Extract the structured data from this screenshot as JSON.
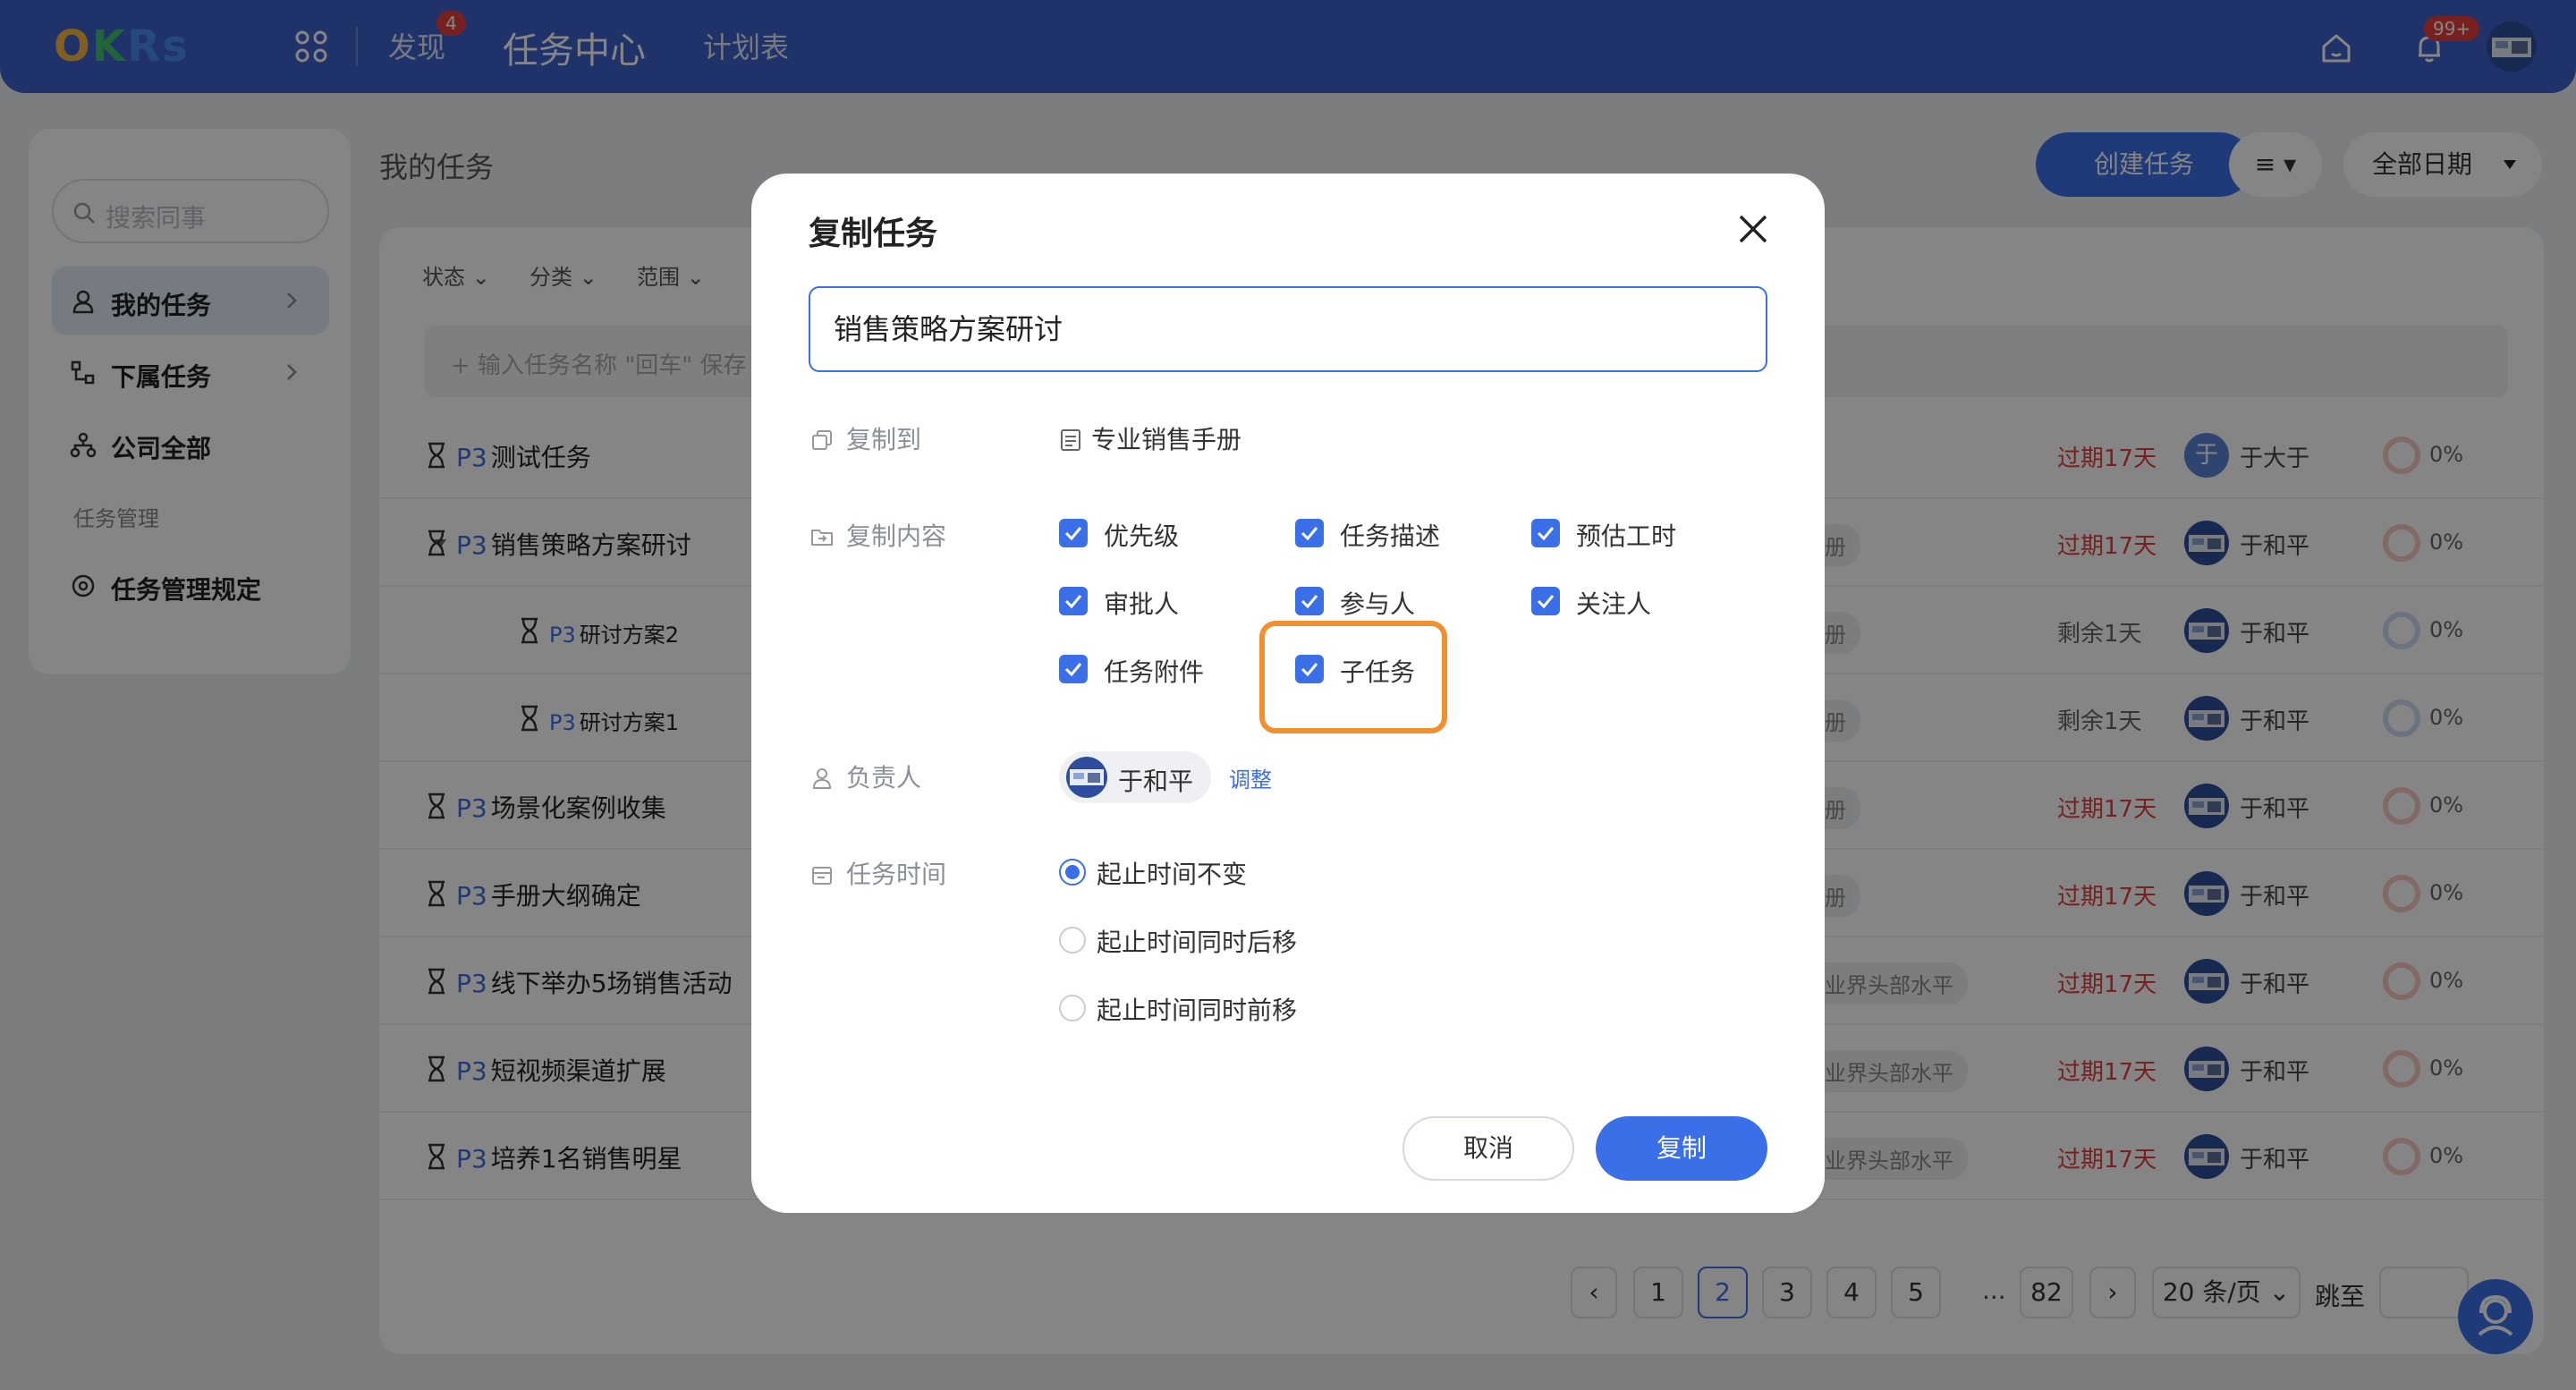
{
  "topbar": {
    "logo": [
      "O",
      "K",
      "Rs"
    ],
    "nav": [
      {
        "label": "发现",
        "badge": "4"
      },
      {
        "label": "任务中心"
      },
      {
        "label": "计划表"
      }
    ],
    "notify_badge": "99+"
  },
  "sidebar": {
    "search_placeholder": "搜索同事",
    "items": [
      {
        "label": "我的任务"
      },
      {
        "label": "下属任务"
      },
      {
        "label": "公司全部"
      }
    ],
    "group_label": "任务管理",
    "rules_label": "任务管理规定"
  },
  "main": {
    "title": "我的任务",
    "create_button": "创建任务",
    "view_icon": "≡ ▾",
    "date_filter": "全部日期",
    "filters": [
      "状态",
      "分类",
      "范围"
    ],
    "quick_add_placeholder": "+ 输入任务名称 \"回车\" 保存"
  },
  "tasks": [
    {
      "priority": "P3",
      "name": "测试任务",
      "tag": "",
      "due": "过期17天",
      "due_color": "red",
      "owner": "于大于",
      "avatar": "于",
      "progress": "0%"
    },
    {
      "priority": "P3",
      "name": "销售策略方案研讨",
      "tag": "册",
      "due": "过期17天",
      "due_color": "red",
      "owner": "于和平",
      "progress": "0%"
    },
    {
      "priority": "P3",
      "name": "研讨方案2",
      "tag": "册",
      "due": "剩余1天",
      "due_color": "gray",
      "owner": "于和平",
      "progress": "0%"
    },
    {
      "priority": "P3",
      "name": "研讨方案1",
      "tag": "册",
      "due": "剩余1天",
      "due_color": "gray",
      "owner": "于和平",
      "progress": "0%"
    },
    {
      "priority": "P3",
      "name": "场景化案例收集",
      "tag": "册",
      "due": "过期17天",
      "due_color": "red",
      "owner": "于和平",
      "progress": "0%"
    },
    {
      "priority": "P3",
      "name": "手册大纲确定",
      "tag": "册",
      "due": "过期17天",
      "due_color": "red",
      "owner": "于和平",
      "progress": "0%"
    },
    {
      "priority": "P3",
      "name": "线下举办5场销售活动",
      "tag": "业界头部水平",
      "due": "过期17天",
      "due_color": "red",
      "owner": "于和平",
      "progress": "0%"
    },
    {
      "priority": "P3",
      "name": "短视频渠道扩展",
      "tag": "业界头部水平",
      "due": "过期17天",
      "due_color": "red",
      "owner": "于和平",
      "progress": "0%"
    },
    {
      "priority": "P3",
      "name": "培养1名销售明星",
      "tag": "业界头部水平",
      "due": "过期17天",
      "due_color": "red",
      "owner": "于和平",
      "progress": "0%"
    }
  ],
  "pagination": {
    "pages": [
      "1",
      "2",
      "3",
      "4",
      "5"
    ],
    "current": "2",
    "dots": "...",
    "last": "82",
    "per_page": "20 条/页",
    "jump_label": "跳至"
  },
  "modal": {
    "title": "复制任务",
    "name_value": "销售策略方案研讨",
    "copy_to_label": "复制到",
    "copy_to_value": "专业销售手册",
    "content_label": "复制内容",
    "checkboxes": [
      {
        "label": "优先级",
        "checked": true
      },
      {
        "label": "任务描述",
        "checked": true
      },
      {
        "label": "预估工时",
        "checked": true
      },
      {
        "label": "审批人",
        "checked": true
      },
      {
        "label": "参与人",
        "checked": true
      },
      {
        "label": "关注人",
        "checked": true
      },
      {
        "label": "任务附件",
        "checked": true
      },
      {
        "label": "子任务",
        "checked": true
      }
    ],
    "owner_label": "负责人",
    "owner_name": "于和平",
    "adjust_label": "调整",
    "time_label": "任务时间",
    "time_options": [
      {
        "label": "起止时间不变",
        "selected": true
      },
      {
        "label": "起止时间同时后移",
        "selected": false
      },
      {
        "label": "起止时间同时前移",
        "selected": false
      }
    ],
    "cancel_label": "取消",
    "confirm_label": "复制"
  },
  "colors": {
    "primary": "#3a6fe8",
    "topbar": "#3c61c9",
    "danger": "#e2403c",
    "highlight": "#f1902e"
  }
}
